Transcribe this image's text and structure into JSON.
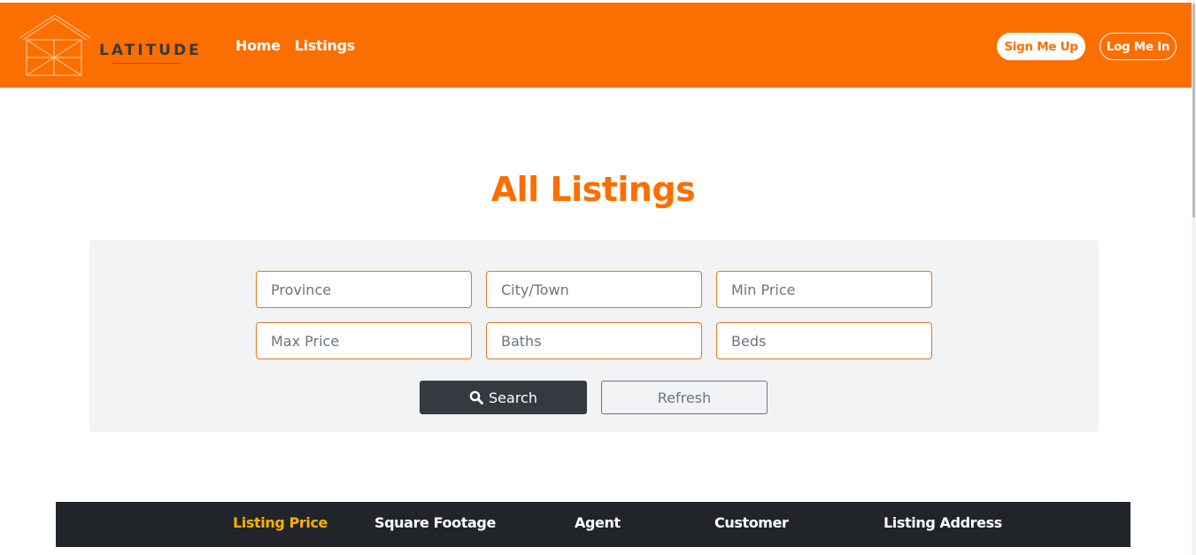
{
  "brand": {
    "name": "LATITUDE"
  },
  "nav": {
    "links": [
      {
        "label": "Home"
      },
      {
        "label": "Listings"
      }
    ],
    "signup_label": "Sign Me Up",
    "login_label": "Log Me In"
  },
  "page": {
    "title": "All Listings"
  },
  "search": {
    "fields": [
      {
        "placeholder": "Province"
      },
      {
        "placeholder": "City/Town"
      },
      {
        "placeholder": "Min Price"
      },
      {
        "placeholder": "Max Price"
      },
      {
        "placeholder": "Baths"
      },
      {
        "placeholder": "Beds"
      }
    ],
    "search_label": "Search",
    "search_icon": "search-icon",
    "refresh_label": "Refresh"
  },
  "table": {
    "columns": [
      {
        "label": "Listing Price",
        "active": true
      },
      {
        "label": "Square Footage"
      },
      {
        "label": "Agent"
      },
      {
        "label": "Customer"
      },
      {
        "label": "Listing Address"
      }
    ]
  },
  "colors": {
    "brand_orange": "#fb6e00",
    "dark": "#343a40",
    "table_header": "#212529",
    "active_column": "#ffb000"
  }
}
